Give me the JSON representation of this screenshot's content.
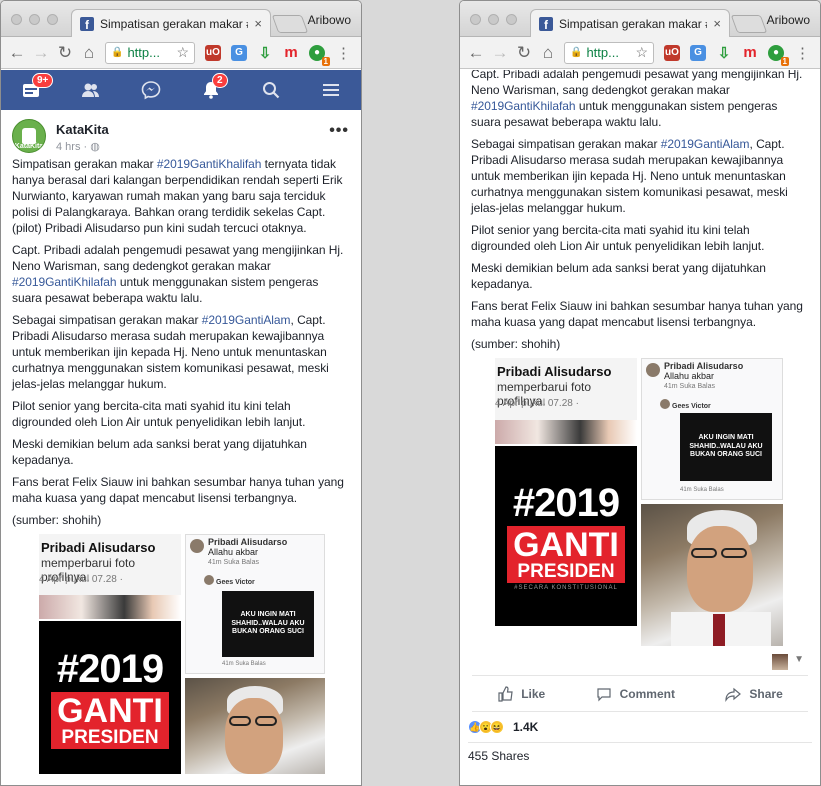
{
  "browser": {
    "tab_title": "Simpatisan gerakan makar #2",
    "tab_close": "×",
    "profile_name": "Aribowo",
    "url": "http..."
  },
  "facebook_bar": {
    "home_badge": "9+",
    "notifications_badge": "2"
  },
  "post": {
    "page_name": "KataKita",
    "avatar_label": "KataKita",
    "time": "4 hrs · ",
    "menu": "•••",
    "paragraphs": [
      [
        {
          "t": "Simpatisan gerakan makar "
        },
        {
          "t": "#2019GantiKhalifah",
          "tag": true
        },
        {
          "t": " ternyata tidak hanya berasal dari kalangan berpendidikan rendah seperti Erik Nurwianto, karyawan rumah makan yang baru saja terciduk polisi di Palangkaraya. Bahkan orang terdidik sekelas Capt. (pilot) Pribadi Alisudarso pun kini sudah tercuci otaknya."
        }
      ],
      [
        {
          "t": "Capt. Pribadi adalah pengemudi pesawat yang mengijinkan Hj. Neno Warisman, sang dedengkot gerakan makar "
        },
        {
          "t": "#2019GantiKhilafah",
          "tag": true
        },
        {
          "t": " untuk menggunakan sistem pengeras suara pesawat beberapa waktu lalu."
        }
      ],
      [
        {
          "t": "Sebagai simpatisan gerakan makar "
        },
        {
          "t": "#2019GantiAlam",
          "tag": true
        },
        {
          "t": ", Capt. Pribadi Alisudarso merasa sudah merupakan kewajibannya untuk memberikan ijin kepada Hj. Neno untuk menuntaskan curhatnya menggunakan sistem komunikasi pesawat, meski jelas-jelas melanggar hukum."
        }
      ],
      [
        {
          "t": "Pilot senior yang bercita-cita mati syahid itu kini telah digrounded oleh Lion Air untuk penyelidikan lebih lanjut."
        }
      ],
      [
        {
          "t": "Meski demikian belum ada sanksi berat yang dijatuhkan kepadanya."
        }
      ],
      [
        {
          "t": "Fans berat Felix Siauw ini bahkan sesumbar hanya tuhan yang maha kuasa yang dapat mencabut lisensi terbangnya."
        }
      ],
      [
        {
          "t": "(sumber: shohih)"
        }
      ]
    ],
    "images": {
      "profile_name": "Pribadi Alisudarso",
      "profile_caption": "memperbarui foto profilnya.",
      "profile_date": "4 Apr pukul 07.28 ·",
      "logo_hash": "#2019",
      "logo_ganti": "GANTI",
      "logo_presiden": "PRESIDEN",
      "logo_sub": "#SECARA KONSTITUSIONAL",
      "comment_top_name": "Pribadi Alisudarso",
      "comment_top_text": "Allahu akbar",
      "comment_top_meta": "41m   Suka   Balas",
      "comment_name": "Gees Victor",
      "comment_box_text": "AKU INGIN MATI SHAHID..WALAU AKU BUKAN ORANG SUCI",
      "comment_bottom_meta": "41m   Suka   Balas"
    },
    "actions": {
      "like": "Like",
      "comment": "Comment",
      "share": "Share"
    },
    "reaction_count": "1.4K",
    "shares": "455 Shares"
  },
  "colors": {
    "facebook_blue": "#3b5998",
    "hashtag": "#365899",
    "notification_red": "#fa3e3e",
    "ganti_red": "#e3232c"
  }
}
